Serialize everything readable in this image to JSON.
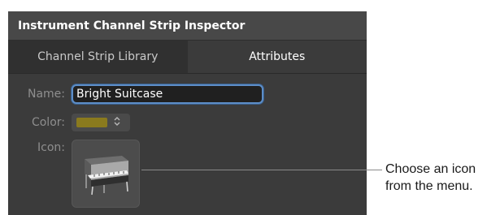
{
  "inspector": {
    "title": "Instrument Channel Strip Inspector",
    "tabs": [
      {
        "label": "Channel Strip Library"
      },
      {
        "label": "Attributes"
      }
    ],
    "name_label": "Name:",
    "name_value": "Bright Suitcase",
    "color_label": "Color:",
    "color_value": "#8a7a1e",
    "icon_label": "Icon:",
    "icon_name": "electric-piano-icon"
  },
  "callout": {
    "line1": "Choose an icon",
    "line2": "from the menu."
  }
}
